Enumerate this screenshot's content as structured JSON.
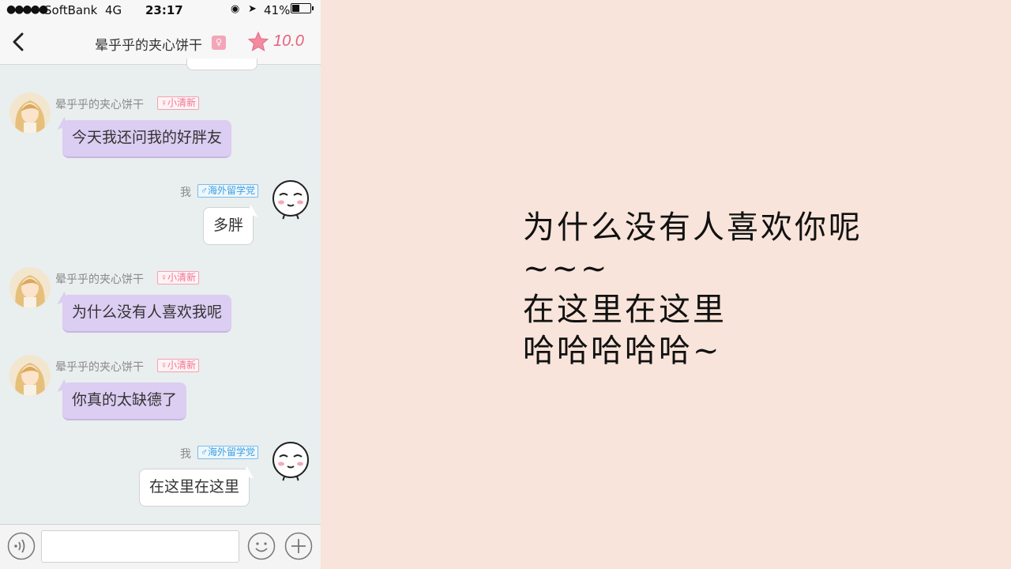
{
  "status_bar": {
    "signal": "●●●●●",
    "carrier": "SoftBank",
    "network": "4G",
    "time": "23:17",
    "battery": "41%",
    "battery_level": 0.41
  },
  "header": {
    "title": "晕乎乎的夹心饼干",
    "badge": "♀",
    "score": "10.0"
  },
  "messages": [
    {
      "side": "left",
      "sender": "晕乎乎的夹心饼干",
      "tag": "♀小清新",
      "text": "今天我还问我的好胖友"
    },
    {
      "side": "right",
      "sender": "我",
      "tag": "♂海外留学党",
      "text": "多胖"
    },
    {
      "side": "left",
      "sender": "晕乎乎的夹心饼干",
      "tag": "♀小清新",
      "text": "为什么没有人喜欢我呢"
    },
    {
      "side": "left",
      "sender": "晕乎乎的夹心饼干",
      "tag": "♀小清新",
      "text": "你真的太缺德了"
    },
    {
      "side": "right",
      "sender": "我",
      "tag": "♂海外留学党",
      "text": "在这里在这里"
    }
  ],
  "input": {
    "placeholder": ""
  },
  "caption": {
    "line1": "为什么没有人喜欢你呢",
    "line2": "~~~",
    "line3": "在这里在这里",
    "line4": "哈哈哈哈哈~"
  },
  "colors": {
    "page_bg": "#f8e4da",
    "chat_bg": "#e9eeee",
    "bubble_left": "#dccdf2",
    "bubble_right": "#ffffff",
    "score": "#e8607a"
  }
}
